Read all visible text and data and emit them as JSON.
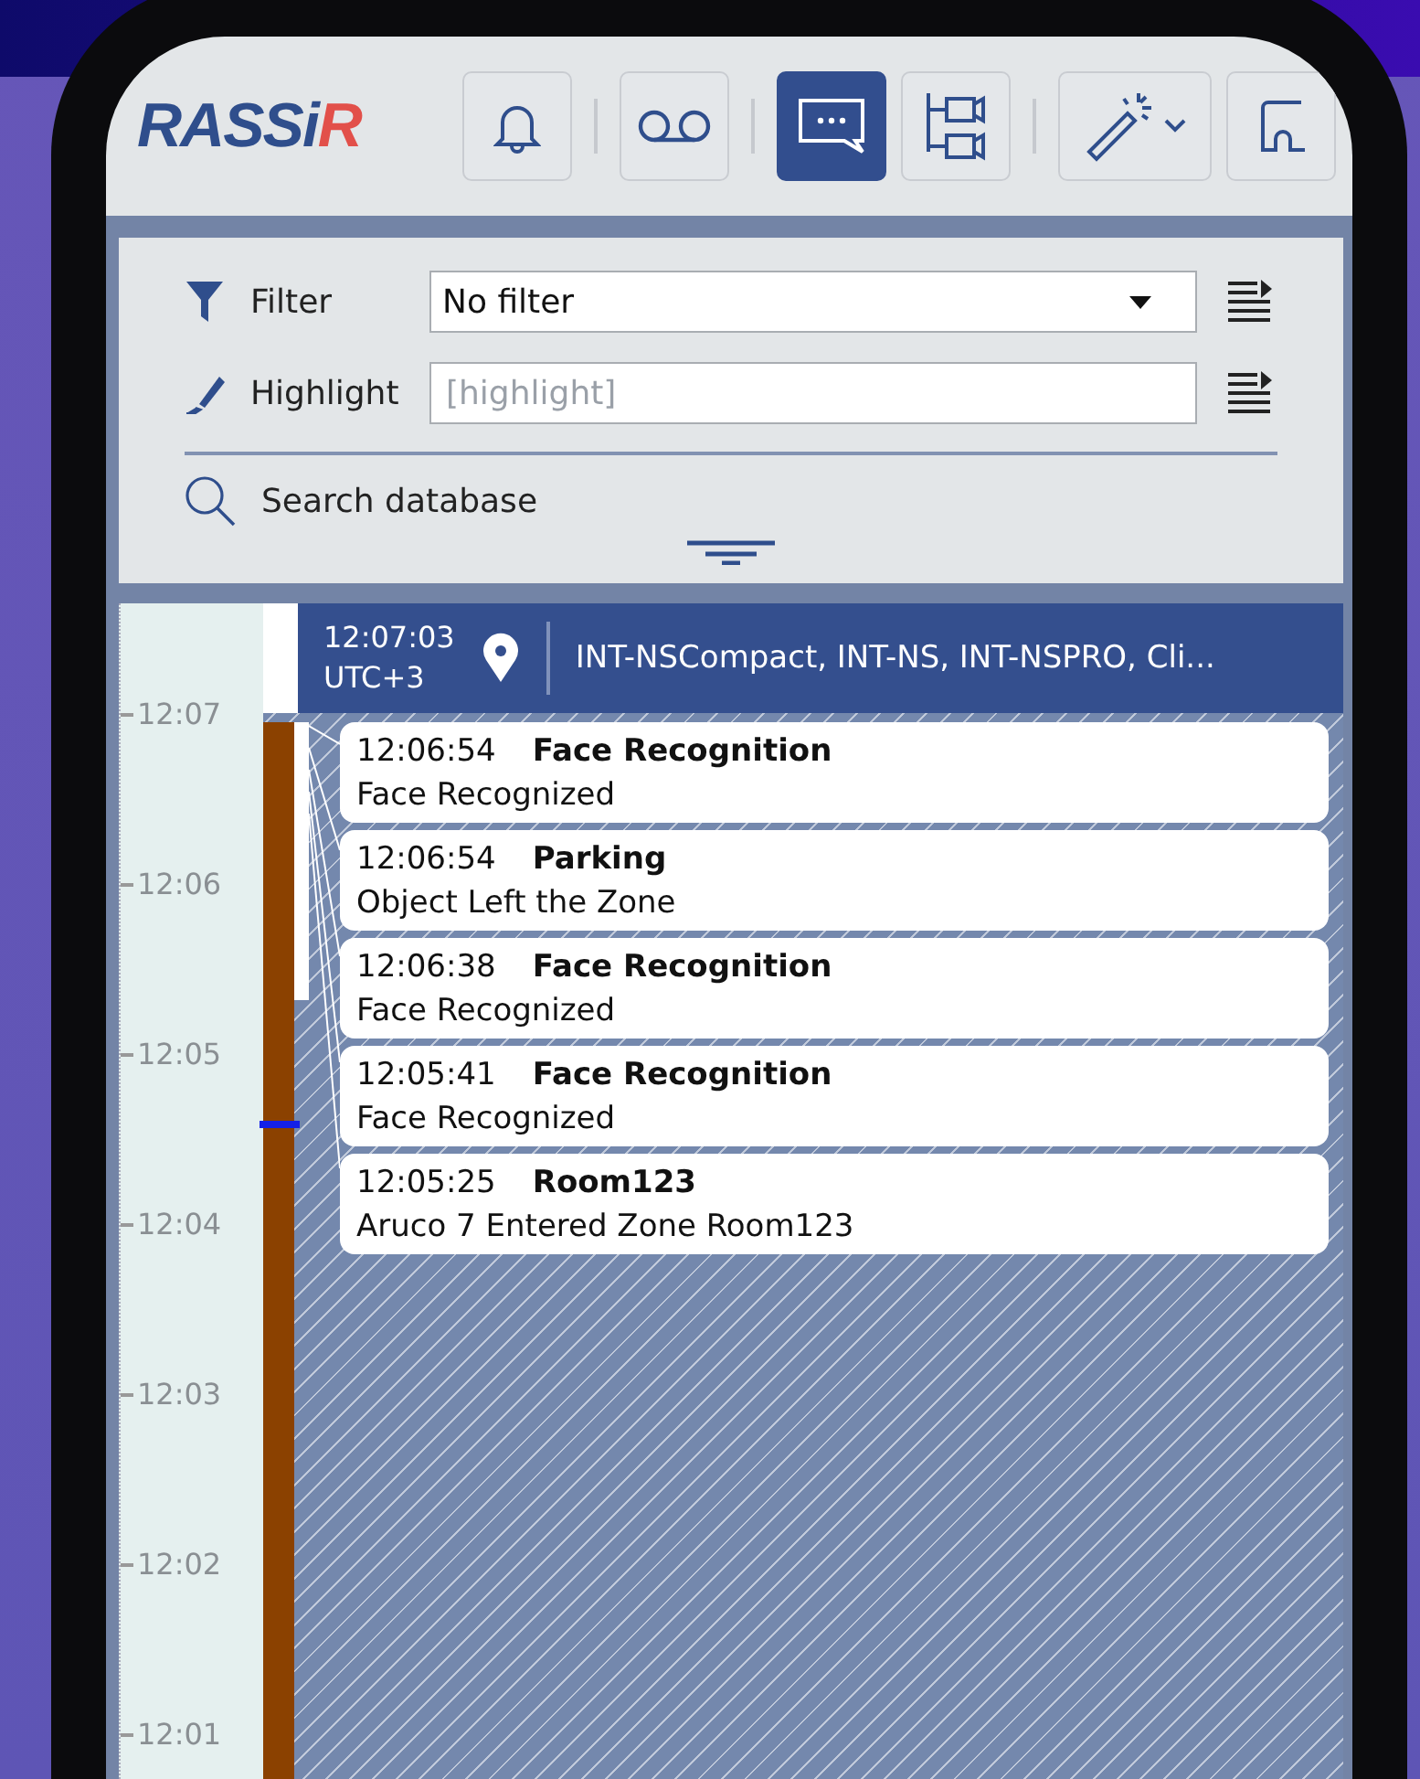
{
  "toolbar": {
    "logo": [
      "RASSi",
      "R"
    ],
    "buttons": [
      {
        "kind": "bell",
        "selected": false
      },
      {
        "kind": "voicemail",
        "selected": false
      },
      {
        "kind": "chat",
        "selected": true
      },
      {
        "kind": "camera-tree",
        "selected": false
      },
      {
        "kind": "wand",
        "selected": false
      },
      {
        "kind": "partial",
        "selected": false
      }
    ]
  },
  "filter": {
    "label": "Filter",
    "value": "No filter"
  },
  "highlight": {
    "label": "Highlight",
    "placeholder": "[highlight]"
  },
  "search": {
    "label": "Search database"
  },
  "timeline": {
    "header": {
      "time": "12:07:03",
      "zone": "UTC+3",
      "location": "INT-NSCompact, INT-NS, INT-NSPRO, Cli..."
    },
    "scale": [
      "12:07",
      "12:06",
      "12:05",
      "12:04",
      "12:03",
      "12:02",
      "12:01"
    ],
    "events": [
      {
        "time": "12:06:54",
        "title": "Face Recognition",
        "description": "Face Recognized"
      },
      {
        "time": "12:06:54",
        "title": "Parking",
        "description": "Object Left the Zone"
      },
      {
        "time": "12:06:38",
        "title": "Face Recognition",
        "description": "Face Recognized"
      },
      {
        "time": "12:05:41",
        "title": "Face Recognition",
        "description": "Face Recognized"
      },
      {
        "time": "12:05:25",
        "title": "Room123",
        "description": "Aruco 7 Entered Zone Room123"
      }
    ]
  }
}
